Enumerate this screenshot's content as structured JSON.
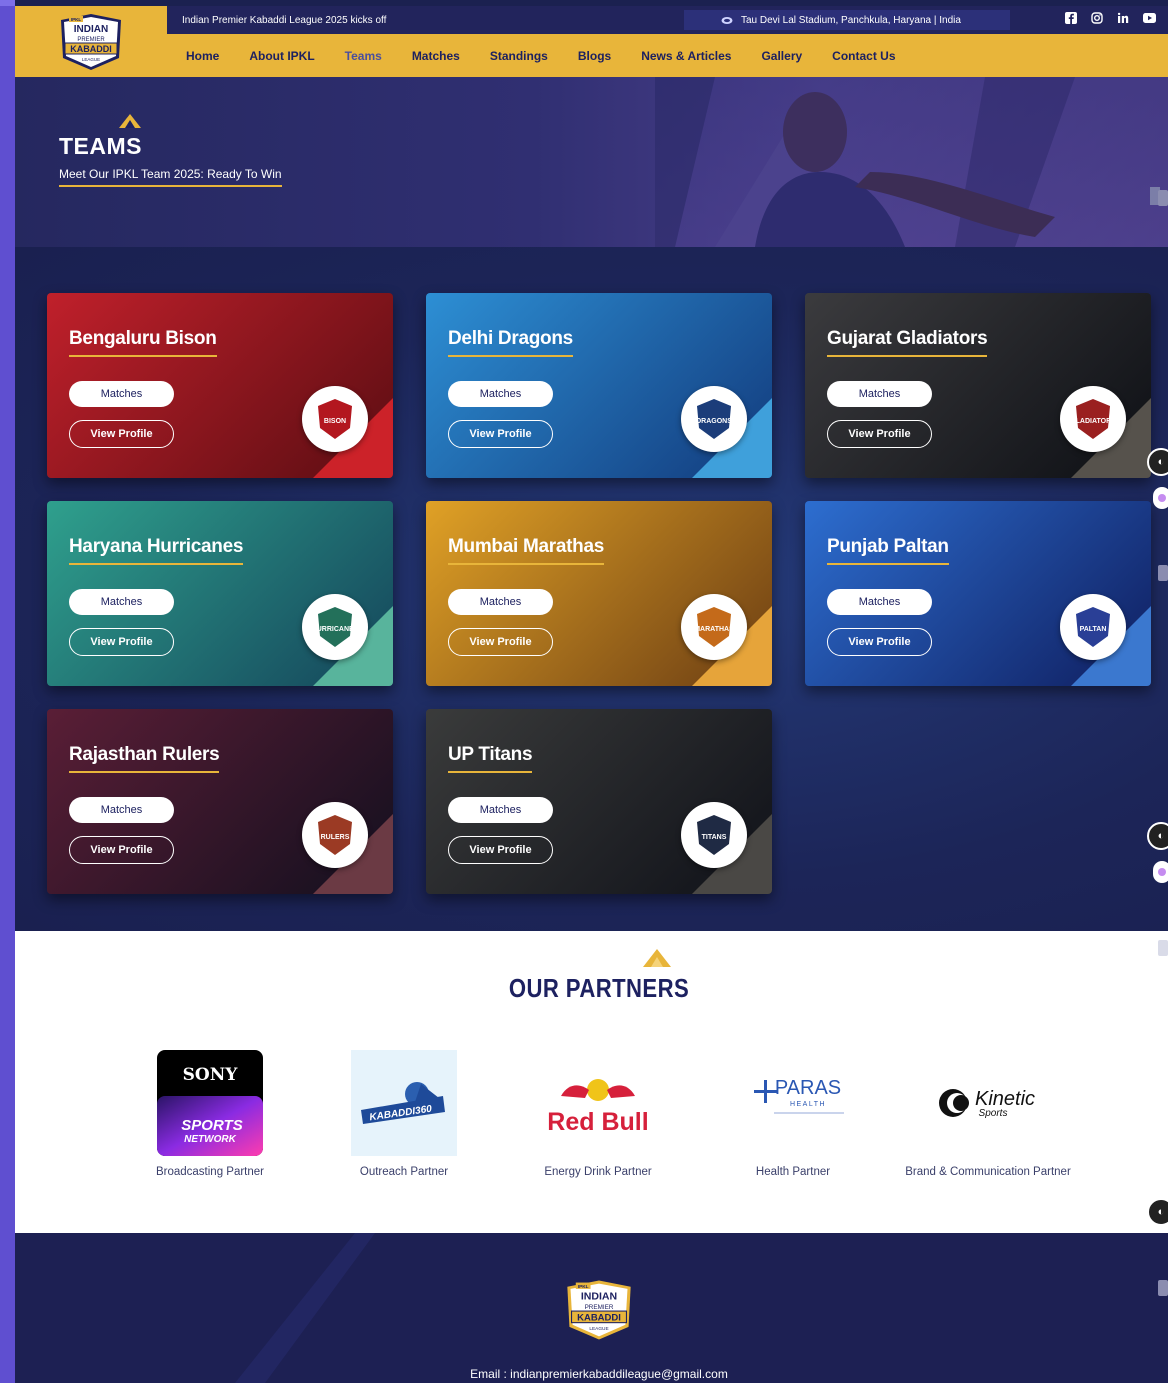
{
  "topbar": {
    "announcement": "Indian Premier Kabaddi League 2025 kicks off",
    "venue": "Tau Devi Lal Stadium, Panchkula, Haryana | India",
    "social_icons": [
      "facebook-icon",
      "instagram-icon",
      "linkedin-icon",
      "youtube-icon"
    ]
  },
  "logo": {
    "line1": "INDIAN",
    "line2": "PREMIER",
    "line3": "KABADDI",
    "line4": "LEAGUE",
    "tag": "IPKL"
  },
  "nav": {
    "items": [
      "Home",
      "About IPKL",
      "Teams",
      "Matches",
      "Standings",
      "Blogs",
      "News & Articles",
      "Gallery",
      "Contact Us"
    ],
    "active": "Teams"
  },
  "hero": {
    "title": "TEAMS",
    "subtitle": "Meet Our IPKL Team 2025: Ready To Win"
  },
  "teams": [
    {
      "name": "Bengaluru Bison",
      "matches_label": "Matches",
      "profile_label": "View Profile",
      "logo_text": "BISON",
      "bg1": "#c0202b",
      "bg2": "#5a0d12",
      "corner": "#cc2229",
      "logo_color": "#b3171f"
    },
    {
      "name": "Delhi Dragons",
      "matches_label": "Matches",
      "profile_label": "View Profile",
      "logo_text": "DRAGONS",
      "bg1": "#2d8fd4",
      "bg2": "#123a7c",
      "corner": "#3fa0db",
      "logo_color": "#1c3d7a"
    },
    {
      "name": "Gujarat Gladiators",
      "matches_label": "Matches",
      "profile_label": "View Profile",
      "logo_text": "GLADIATORS",
      "bg1": "#3b3b3e",
      "bg2": "#0d0f14",
      "corner": "#56524c",
      "logo_color": "#9a2020"
    },
    {
      "name": "Haryana Hurricanes",
      "matches_label": "Matches",
      "profile_label": "View Profile",
      "logo_text": "HURRICANES",
      "bg1": "#2fa08d",
      "bg2": "#14445a",
      "corner": "#58b49c",
      "logo_color": "#23705a"
    },
    {
      "name": "Mumbai Marathas",
      "matches_label": "Matches",
      "profile_label": "View Profile",
      "logo_text": "MARATHAS",
      "bg1": "#e0a126",
      "bg2": "#6b3d13",
      "corner": "#e6a43a",
      "logo_color": "#c46a1a"
    },
    {
      "name": "Punjab Paltan",
      "matches_label": "Matches",
      "profile_label": "View Profile",
      "logo_text": "PALTAN",
      "bg1": "#2d6ed0",
      "bg2": "#0f1d5e",
      "corner": "#3b78cf",
      "logo_color": "#2a3f96"
    },
    {
      "name": "Rajasthan Rulers",
      "matches_label": "Matches",
      "profile_label": "View Profile",
      "logo_text": "RULERS",
      "bg1": "#5a1e36",
      "bg2": "#120f1e",
      "corner": "#6b3a44",
      "logo_color": "#9b3a24"
    },
    {
      "name": "UP Titans",
      "matches_label": "Matches",
      "profile_label": "View Profile",
      "logo_text": "TITANS",
      "bg1": "#3a3b3b",
      "bg2": "#0f1118",
      "corner": "#4a4845",
      "logo_color": "#1f2a44"
    }
  ],
  "partners": {
    "title": "OUR PARTNERS",
    "items": [
      {
        "role": "Broadcasting Partner",
        "brand": "SONY",
        "brand_sub1": "SPORTS",
        "brand_sub2": "NETWORK"
      },
      {
        "role": "Outreach Partner",
        "brand": "KABADDI360"
      },
      {
        "role": "Energy Drink Partner",
        "brand": "Red Bull"
      },
      {
        "role": "Health Partner",
        "brand": "PARAS",
        "brand_sub1": "HEALTH"
      },
      {
        "role": "Brand & Communication Partner",
        "brand": "Kinetic",
        "brand_sub1": "Sports"
      }
    ]
  },
  "footer": {
    "email": "Email : indianpremierkabaddileague@gmail.com"
  }
}
